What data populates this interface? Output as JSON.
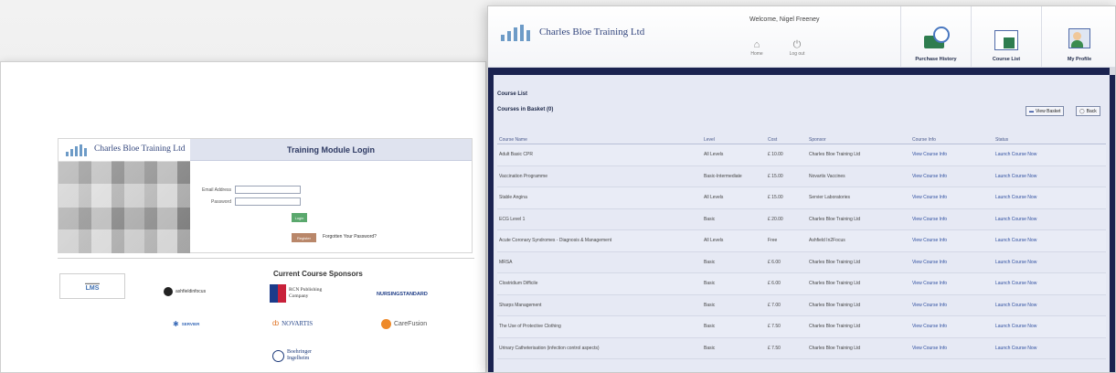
{
  "login_page": {
    "logo_text": "Charles Bloe Training Ltd",
    "title": "Training Module Login",
    "email_label": "Email Address",
    "password_label": "Password",
    "login_button": "Login",
    "register_button": "Register",
    "forgot_link": "Forgotten Your Password?",
    "sponsors_heading": "Current Course Sponsors",
    "sponsors": {
      "lms": "LMS",
      "ashfield": "ashfieldinfocus",
      "rcn_line1": "RCN Publishing",
      "rcn_line2": "Company",
      "nursing": "NURSINGSTANDARD",
      "servier": "SERVIER",
      "novartis": "NOVARTIS",
      "carefusion": "CareFusion",
      "boehringer_line1": "Boehringer",
      "boehringer_line2": "Ingelheim"
    }
  },
  "course_window": {
    "logo_text": "Charles Bloe Training Ltd",
    "welcome": "Welcome, Nigel Freeney",
    "home_label": "Home",
    "logout_label": "Log out",
    "toolbar": {
      "purchase_history": "Purchase History",
      "course_list": "Course List",
      "my_profile": "My Profile"
    },
    "page_title": "Course List",
    "basket_title": "Courses in Basket (0)",
    "view_basket_button": "View Basket",
    "back_button": "Back",
    "columns": [
      "Course Name",
      "Level",
      "Cost",
      "Sponsor",
      "Course Info",
      "Status"
    ],
    "rows": [
      {
        "name": "Adult Basic CPR",
        "level": "All Levels",
        "cost": "£ 10.00",
        "sponsor": "Charles Bloe Training Ltd",
        "info": "View Course Info",
        "status": "Launch Course Now"
      },
      {
        "name": "Vaccination Programme",
        "level": "Basic-Intermediate",
        "cost": "£ 15.00",
        "sponsor": "Novartis Vaccines",
        "info": "View Course Info",
        "status": "Launch Course Now"
      },
      {
        "name": "Stable Angina",
        "level": "All Levels",
        "cost": "£ 15.00",
        "sponsor": "Servier Laboratories",
        "info": "View Course Info",
        "status": "Launch Course Now"
      },
      {
        "name": "ECG Level 1",
        "level": "Basic",
        "cost": "£ 20.00",
        "sponsor": "Charles Bloe Training Ltd",
        "info": "View Course Info",
        "status": "Launch Course Now"
      },
      {
        "name": "Acute Coronary Syndromes - Diagnosis & Management",
        "level": "All Levels",
        "cost": "Free",
        "sponsor": "Ashfield In2Focus",
        "info": "View Course Info",
        "status": "Launch Course Now"
      },
      {
        "name": "MRSA",
        "level": "Basic",
        "cost": "£ 6.00",
        "sponsor": "Charles Bloe Training Ltd",
        "info": "View Course Info",
        "status": "Launch Course Now"
      },
      {
        "name": "Clostridium Difficile",
        "level": "Basic",
        "cost": "£ 6.00",
        "sponsor": "Charles Bloe Training Ltd",
        "info": "View Course Info",
        "status": "Launch Course Now"
      },
      {
        "name": "Sharps Management",
        "level": "Basic",
        "cost": "£ 7.00",
        "sponsor": "Charles Bloe Training Ltd",
        "info": "View Course Info",
        "status": "Launch Course Now"
      },
      {
        "name": "The Use of Protective Clothing",
        "level": "Basic",
        "cost": "£ 7.50",
        "sponsor": "Charles Bloe Training Ltd",
        "info": "View Course Info",
        "status": "Launch Course Now"
      },
      {
        "name": "Urinary Catheterisation (infection control aspects)",
        "level": "Basic",
        "cost": "£ 7.50",
        "sponsor": "Charles Bloe Training Ltd",
        "info": "View Course Info",
        "status": "Launch Course Now"
      }
    ]
  }
}
